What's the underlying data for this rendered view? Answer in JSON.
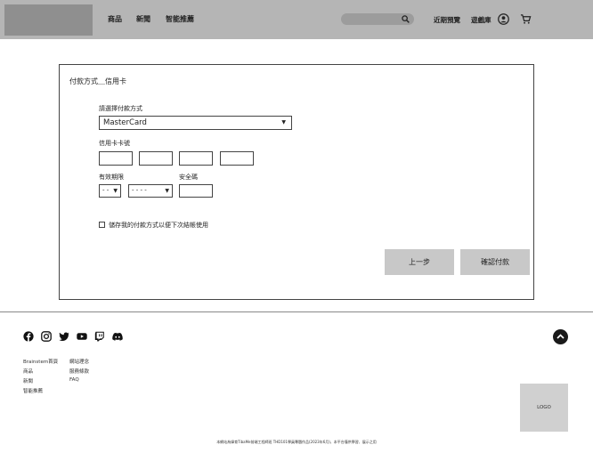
{
  "header": {
    "nav": [
      "商品",
      "新聞",
      "智能推薦"
    ],
    "links": [
      "近期預覽",
      "遊戲庫"
    ],
    "icons": [
      "search-icon",
      "user-icon",
      "cart-icon"
    ]
  },
  "form": {
    "title": "付款方式＿信用卡",
    "method_label": "請選擇付款方式",
    "method_value": "MasterCard",
    "card_number_label": "信用卡卡號",
    "expiry_label": "有效期限",
    "expiry_month": "- -",
    "expiry_year": "- - - -",
    "cvv_label": "安全碼",
    "save_label": "儲存我的付款方式以便下次結帳使用",
    "back_button": "上一步",
    "confirm_button": "確認付款"
  },
  "footer": {
    "social_icons": [
      "facebook-icon",
      "instagram-icon",
      "twitter-icon",
      "youtube-icon",
      "twitch-icon",
      "discord-icon"
    ],
    "col1": [
      "Brainstem首頁",
      "商品",
      "新聞",
      "智能推薦"
    ],
    "col2": [
      "網站理念",
      "服務條款",
      "FAQ"
    ],
    "logo": "LOGO",
    "copyright": "本網站為緯育TibaMe前端工程師班 THD101學員專題作品(2023年6月)，本平台僅供學習、展示之用"
  }
}
